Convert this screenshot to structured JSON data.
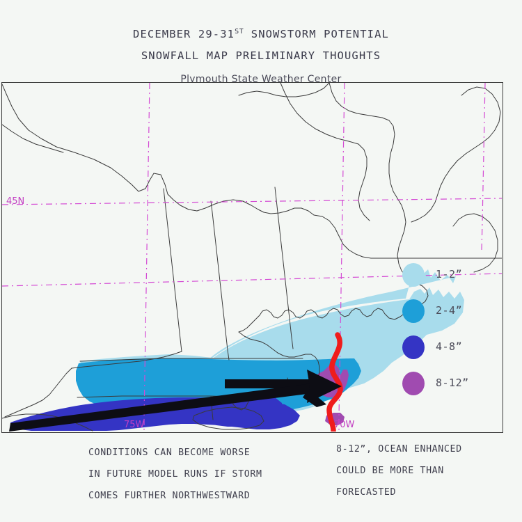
{
  "header": {
    "title_line1_pre": "DECEMBER 29-31",
    "title_line1_sup": "ST",
    "title_line1_post": " SNOWSTORM POTENTIAL",
    "title_line2": "SNOWFALL MAP PRELIMINARY THOUGHTS",
    "subtitle": "Plymouth State Weather Center"
  },
  "legend": {
    "items": [
      {
        "label": "1-2”",
        "color": "#a8dcec"
      },
      {
        "label": "2-4”",
        "color": "#1e9fd8"
      },
      {
        "label": "4-8”",
        "color": "#3434c4"
      },
      {
        "label": "8-12”",
        "color": "#a04bb0"
      }
    ]
  },
  "map": {
    "graticule": {
      "lat_label": "45N",
      "lon_label_west": "75W",
      "lon_label_east": "70W",
      "line_color": "#d44ad4"
    },
    "coast_color": "#3a3a3a",
    "storm_track_color": "#ef1c1c",
    "arrow_color": "#0d0d14",
    "background": "#f4f7f4"
  },
  "notes": {
    "left": [
      "CONDITIONS CAN BECOME WORSE",
      "IN FUTURE MODEL RUNS IF STORM",
      "COMES FURTHER NORTHWESTWARD"
    ],
    "right": [
      "8-12”, OCEAN ENHANCED",
      "COULD BE MORE THAN",
      "FORECASTED"
    ]
  }
}
